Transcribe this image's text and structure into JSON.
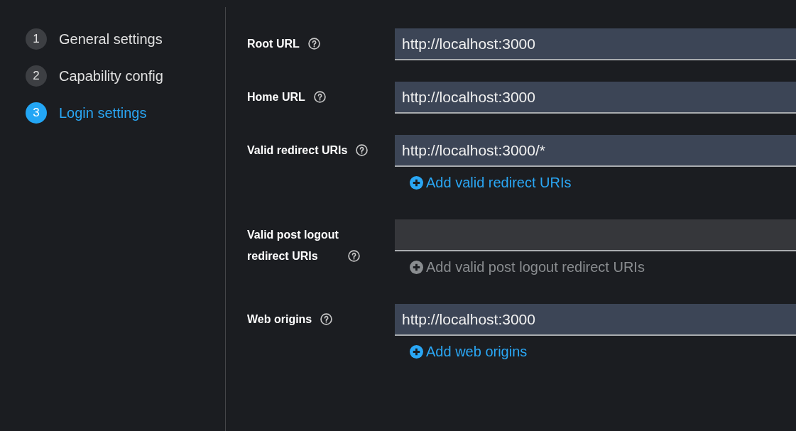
{
  "wizard_steps": [
    {
      "number": "1",
      "label": "General settings",
      "selected": false
    },
    {
      "number": "2",
      "label": "Capability config",
      "selected": false
    },
    {
      "number": "3",
      "label": "Login settings",
      "selected": true
    }
  ],
  "fields": [
    {
      "label": "Root URL",
      "value": "http://localhost:3000"
    },
    {
      "label": "Home URL",
      "value": "http://localhost:3000"
    },
    {
      "label": "Valid redirect URIs",
      "value": "http://localhost:3000/*",
      "add_link": {
        "label": "Add valid redirect URIs",
        "disabled": false
      }
    },
    {
      "label": "Valid post logout redirect URIs",
      "add_link": {
        "label": "Add valid post logout redirect URIs",
        "disabled": true
      }
    },
    {
      "label": "Web origins",
      "value": "http://localhost:3000",
      "add_link": {
        "label": "Add web origins",
        "disabled": false
      }
    }
  ]
}
